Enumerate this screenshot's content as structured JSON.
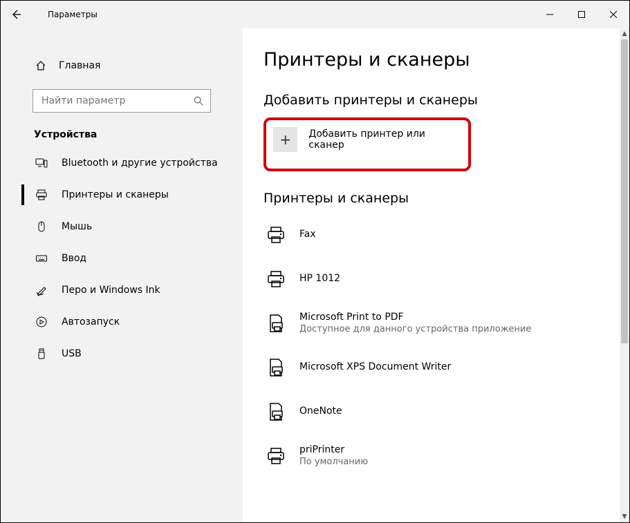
{
  "window": {
    "title": "Параметры"
  },
  "sidebar": {
    "home": "Главная",
    "search_placeholder": "Найти параметр",
    "section": "Устройства",
    "items": [
      {
        "label": "Bluetooth и другие устройства"
      },
      {
        "label": "Принтеры и сканеры"
      },
      {
        "label": "Мышь"
      },
      {
        "label": "Ввод"
      },
      {
        "label": "Перо и Windows Ink"
      },
      {
        "label": "Автозапуск"
      },
      {
        "label": "USB"
      }
    ]
  },
  "main": {
    "title": "Принтеры и сканеры",
    "add_heading": "Добавить принтеры и сканеры",
    "add_button": "Добавить принтер или сканер",
    "list_heading": "Принтеры и сканеры",
    "printers": [
      {
        "name": "Fax",
        "sub": ""
      },
      {
        "name": "HP 1012",
        "sub": ""
      },
      {
        "name": "Microsoft Print to PDF",
        "sub": "Доступное для данного устройства приложение"
      },
      {
        "name": "Microsoft XPS Document Writer",
        "sub": ""
      },
      {
        "name": "OneNote",
        "sub": ""
      },
      {
        "name": "priPrinter",
        "sub": "По умолчанию"
      }
    ]
  },
  "highlight": {
    "color": "#d3000d"
  }
}
